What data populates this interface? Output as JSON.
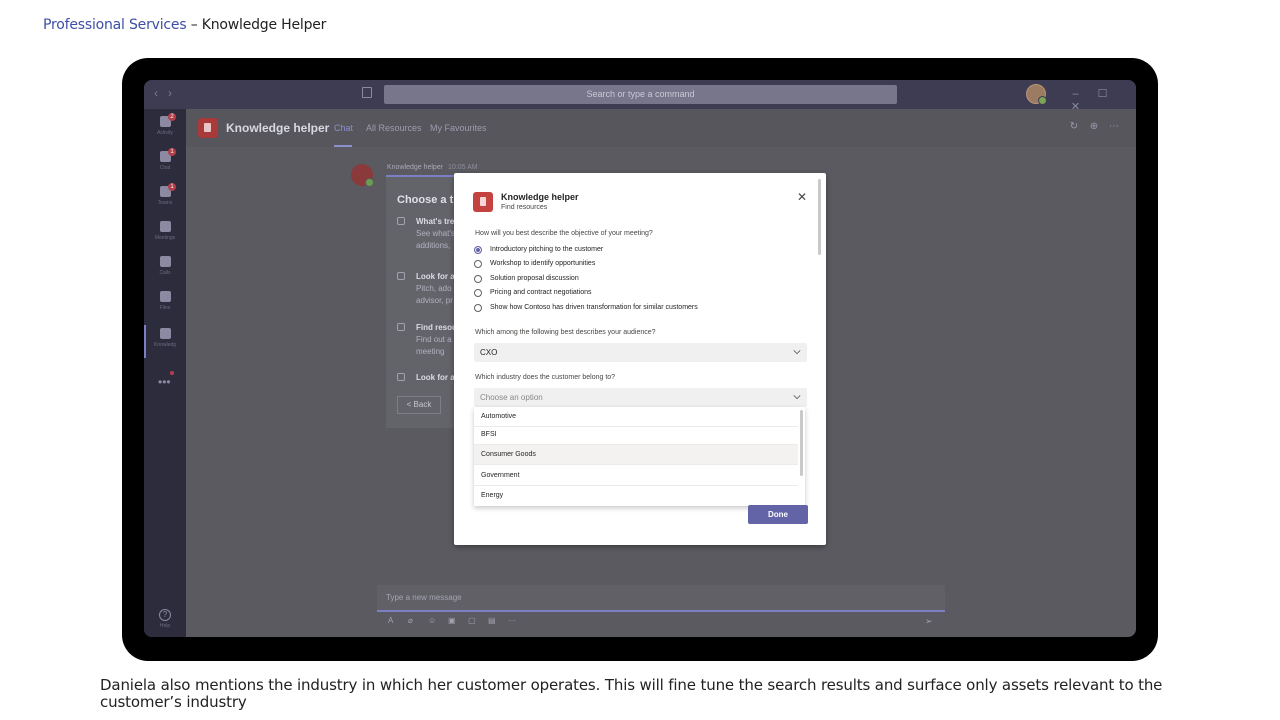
{
  "slide": {
    "title_part1": "Professional Services",
    "title_part2": " – Knowledge  Helper",
    "caption": "Daniela also mentions the industry in which her customer operates. This will fine tune the search results and surface only assets relevant to the customer’s industry"
  },
  "teams": {
    "titlebar": {
      "search_placeholder": "Search or type a command",
      "window_controls": [
        "–",
        "☐",
        "✕"
      ]
    },
    "rail": [
      {
        "label": "Activity",
        "badge": "2",
        "icon": "bell-icon"
      },
      {
        "label": "Chat",
        "badge": "1",
        "icon": "chat-icon"
      },
      {
        "label": "Teams",
        "badge": "1",
        "icon": "teams-icon"
      },
      {
        "label": "Meetings",
        "badge": "",
        "icon": "calendar-icon"
      },
      {
        "label": "Calls",
        "badge": "",
        "icon": "phone-icon"
      },
      {
        "label": "Files",
        "badge": "",
        "icon": "file-icon"
      },
      {
        "label": "Knowledg",
        "badge": "",
        "icon": "knowledge-icon"
      }
    ],
    "rail_more": "•••",
    "rail_help_label": "Help",
    "app_header": {
      "app_name": "Knowledge helper",
      "tabs": [
        "Chat",
        "All Resources",
        "My Favourites"
      ],
      "active_tab": "Chat"
    },
    "background_card": {
      "sender": "Knowledge helper",
      "time": "10:05 AM",
      "title": "Choose a t",
      "items": [
        {
          "title": "What's tre",
          "sub1": "See what's",
          "sub2": "additions,"
        },
        {
          "title": "Look for a",
          "sub1": "Pitch, ado",
          "sub2": "advisor, pr"
        },
        {
          "title": "Find resou",
          "sub1": "Find out a",
          "sub2": "meeting"
        },
        {
          "title": "Look for a",
          "sub1": "",
          "sub2": ""
        }
      ],
      "back_label": "< Back"
    },
    "composer_placeholder": "Type a new message"
  },
  "dialog": {
    "title": "Knowledge helper",
    "subtitle": "Find resources",
    "q1": "How will you best describe the objective of your meeting?",
    "q1_options": [
      "Introductory pitching to the customer",
      "Workshop to identify opportunities",
      "Solution proposal discussion",
      "Pricing and contract negotiations",
      "Show how Contoso has driven transformation for similar customers"
    ],
    "q1_selected_index": 0,
    "q2": "Which among the following best describes your audience?",
    "q2_value": "CXO",
    "q3": "Which industry does the customer belong to?",
    "q3_placeholder": "Choose an option",
    "q3_options": [
      "Automotive",
      "BFSI",
      "Consumer Goods",
      "Government",
      "Energy"
    ],
    "q3_hover_index": 2,
    "done_label": "Done"
  },
  "colors": {
    "accent": "#6264a7",
    "slide_title_blue": "#3d4ea3",
    "app_red": "#c4423f"
  }
}
